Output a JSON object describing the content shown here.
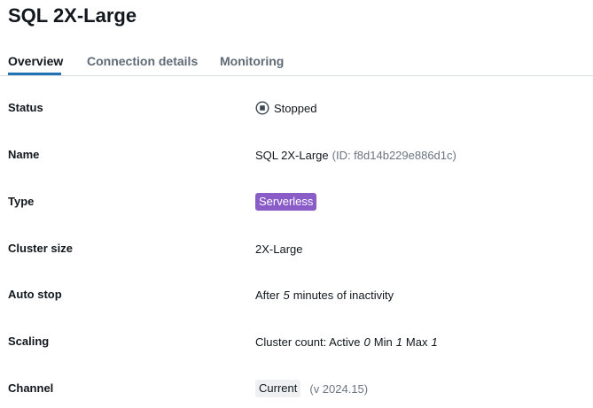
{
  "header": {
    "title": "SQL 2X-Large"
  },
  "tabs": [
    {
      "label": "Overview",
      "active": true
    },
    {
      "label": "Connection details",
      "active": false
    },
    {
      "label": "Monitoring",
      "active": false
    }
  ],
  "details": {
    "status": {
      "label": "Status",
      "value": "Stopped",
      "icon": "stop-circle-icon"
    },
    "name": {
      "label": "Name",
      "value": "SQL 2X-Large",
      "id_text": "(ID: f8d14b229e886d1c)"
    },
    "type": {
      "label": "Type",
      "badge": "Serverless",
      "badge_color": "#8a5cc7"
    },
    "cluster_size": {
      "label": "Cluster size",
      "value": "2X-Large"
    },
    "auto_stop": {
      "label": "Auto stop",
      "prefix": "After",
      "minutes": "5",
      "suffix": "minutes of inactivity"
    },
    "scaling": {
      "label": "Scaling",
      "prefix": "Cluster count: Active",
      "active": "0",
      "min_label": "Min",
      "min": "1",
      "max_label": "Max",
      "max": "1"
    },
    "channel": {
      "label": "Channel",
      "tag": "Current",
      "version": "(v 2024.15)"
    }
  },
  "colors": {
    "accent": "#2272b4",
    "serverless_badge": "#8a5cc7"
  }
}
